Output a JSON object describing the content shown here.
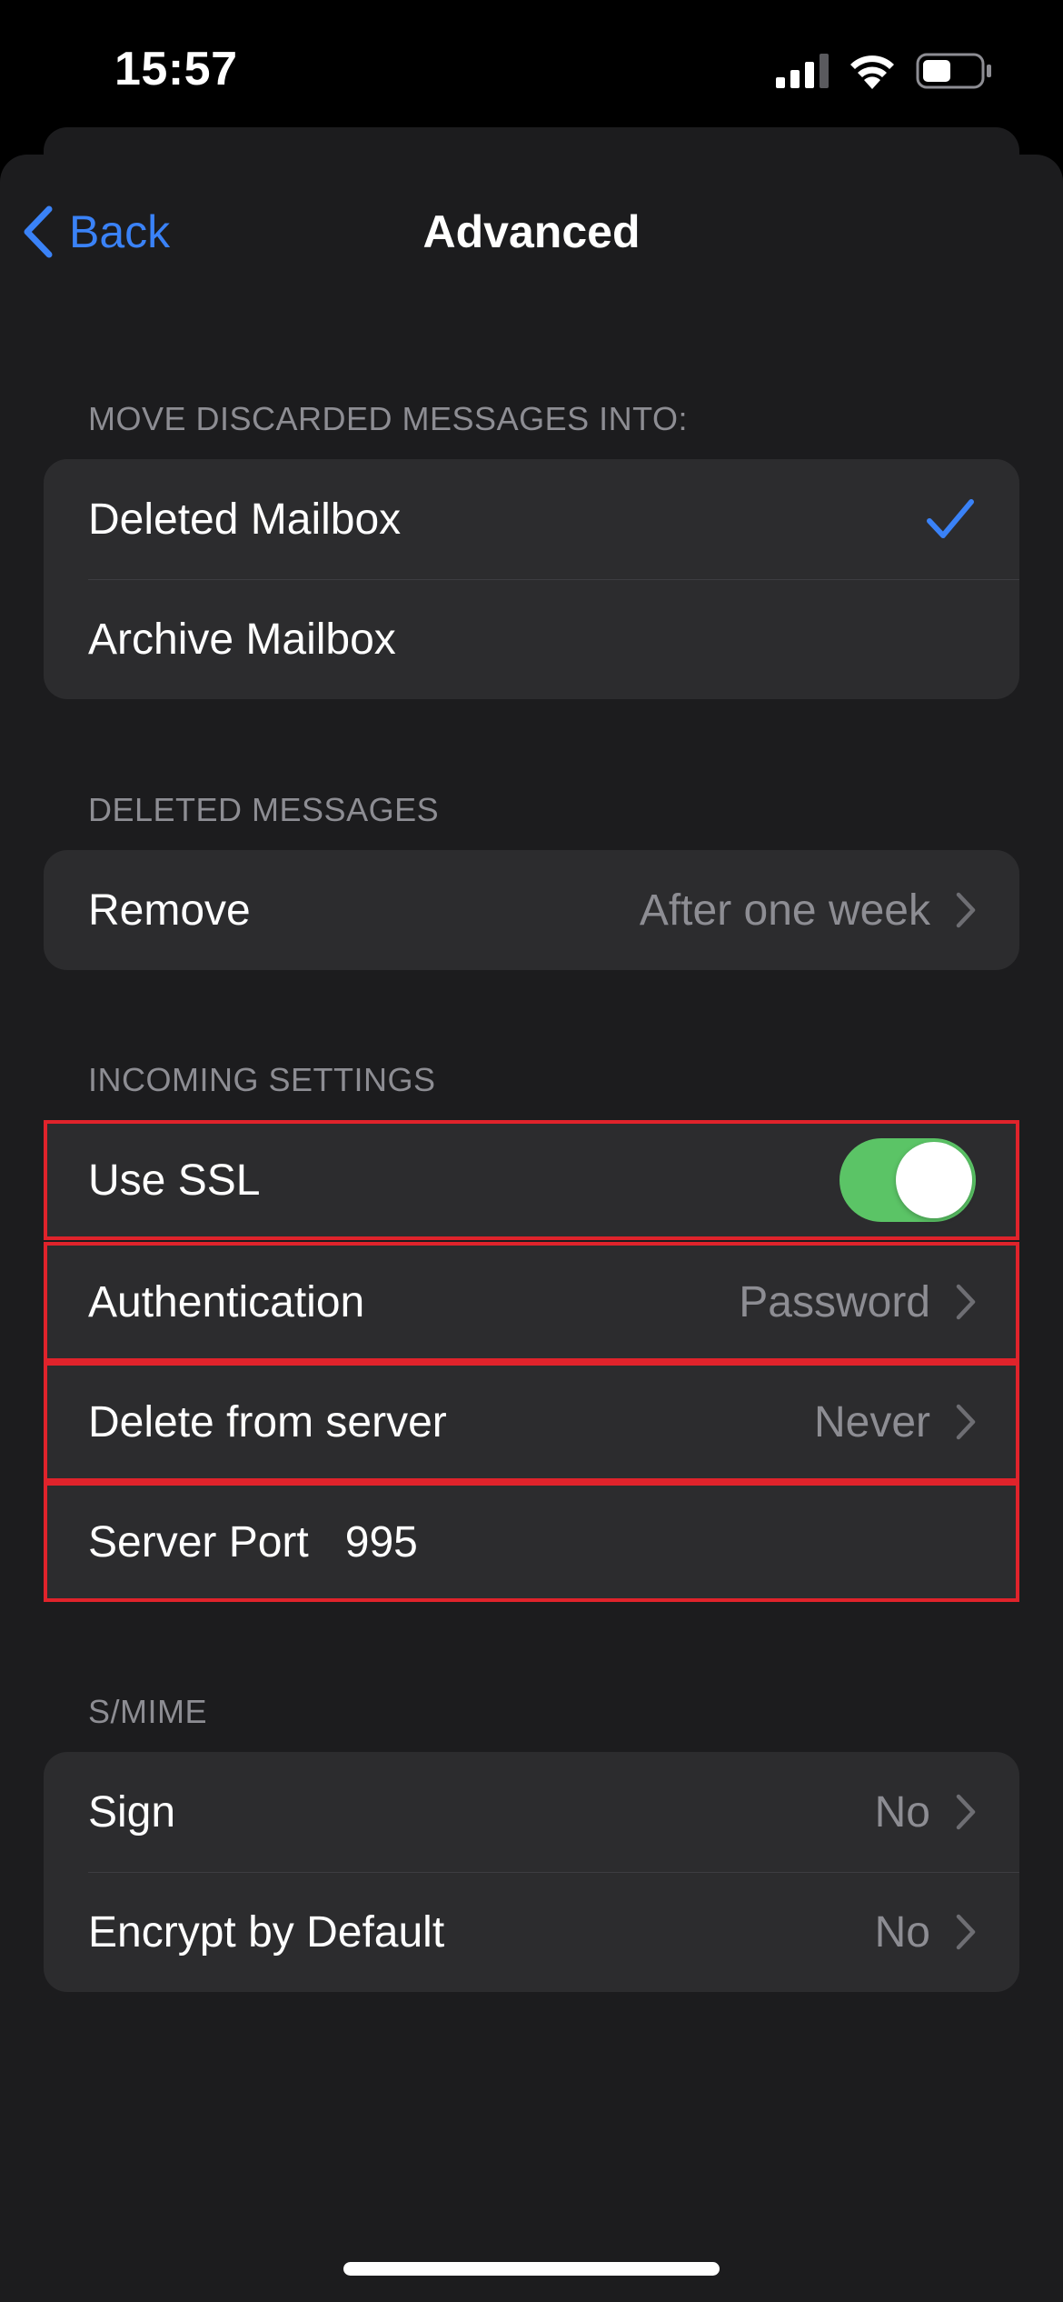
{
  "status_bar": {
    "time": "15:57",
    "icons": [
      "cellular-signal-icon",
      "wifi-icon",
      "battery-icon"
    ]
  },
  "nav": {
    "back_label": "Back",
    "title": "Advanced"
  },
  "sections": {
    "discarded": {
      "header": "MOVE DISCARDED MESSAGES INTO:",
      "items": [
        {
          "label": "Deleted Mailbox",
          "selected": true
        },
        {
          "label": "Archive Mailbox",
          "selected": false
        }
      ]
    },
    "deleted": {
      "header": "DELETED MESSAGES",
      "items": [
        {
          "label": "Remove",
          "value": "After one week"
        }
      ]
    },
    "incoming": {
      "header": "INCOMING SETTINGS",
      "use_ssl": {
        "label": "Use SSL",
        "on": true
      },
      "authentication": {
        "label": "Authentication",
        "value": "Password"
      },
      "delete_from_server": {
        "label": "Delete from server",
        "value": "Never"
      },
      "server_port": {
        "label": "Server Port",
        "value": "995"
      }
    },
    "smime": {
      "header": "S/MIME",
      "items": [
        {
          "label": "Sign",
          "value": "No"
        },
        {
          "label": "Encrypt by Default",
          "value": "No"
        }
      ]
    }
  },
  "colors": {
    "accent": "#3a82f7",
    "toggle_on": "#5bc466",
    "highlight_border": "#e0232b",
    "background": "#1c1c1e",
    "cell": "#2c2c2e",
    "secondary_text": "#8d8d93"
  }
}
